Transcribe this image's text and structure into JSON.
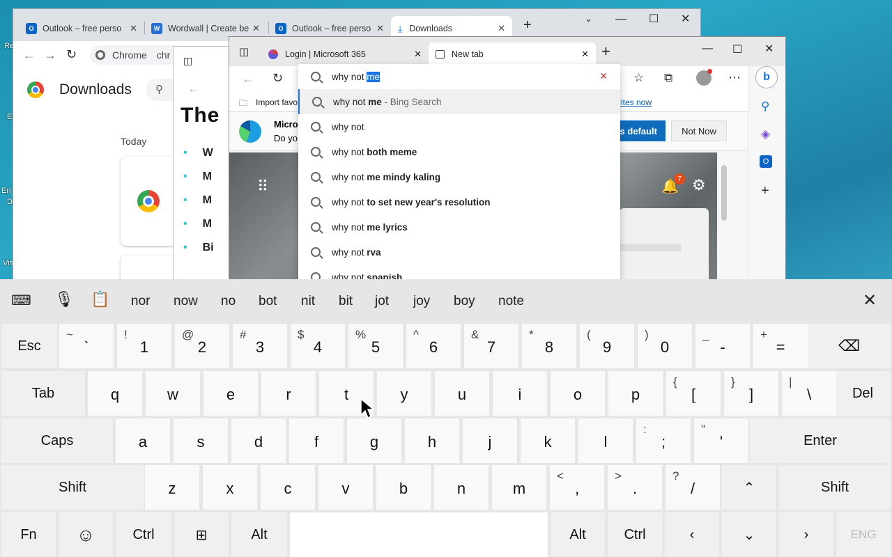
{
  "desktop": {
    "labels": [
      "Re",
      "E",
      "Ev",
      "En",
      "D",
      "Vis"
    ]
  },
  "chrome": {
    "tabs": [
      {
        "label": "Outlook – free perso",
        "icon": "outlook-icon"
      },
      {
        "label": "Wordwall | Create be",
        "icon": "wordwall-icon"
      },
      {
        "label": "Outlook – free perso",
        "icon": "outlook-icon"
      },
      {
        "label": "Downloads",
        "icon": "download-icon",
        "active": true
      }
    ],
    "address": "Chrome",
    "address_text": "chr",
    "page_title": "Downloads",
    "today": "Today"
  },
  "middle": {
    "heading": "The",
    "items": [
      "W",
      "M",
      "M",
      "M",
      "Bi"
    ]
  },
  "edge": {
    "tabs": [
      {
        "label": "Login | Microsoft 365"
      },
      {
        "label": "New tab",
        "active": true
      }
    ],
    "fav_label": "Import favo",
    "fav_link": "rites now",
    "banner_title": "Micros",
    "banner_sub": "Do yo",
    "make_default": "s default",
    "not_now": "Not Now",
    "notif_count": "7"
  },
  "search": {
    "typed": "why not ",
    "selected": "me",
    "suggestions": [
      {
        "prefix": "why not ",
        "bold": "me",
        "suffix": " - Bing Search"
      },
      {
        "prefix": "why not",
        "bold": "",
        "suffix": ""
      },
      {
        "prefix": "why not ",
        "bold": "both meme",
        "suffix": ""
      },
      {
        "prefix": "why not ",
        "bold": "me mindy kaling",
        "suffix": ""
      },
      {
        "prefix": "why not ",
        "bold": "to set new year's resolution",
        "suffix": ""
      },
      {
        "prefix": "why not ",
        "bold": "me lyrics",
        "suffix": ""
      },
      {
        "prefix": "why not ",
        "bold": "rva",
        "suffix": ""
      },
      {
        "prefix": "why not ",
        "bold": "spanish",
        "suffix": ""
      }
    ]
  },
  "keyboard": {
    "candidates": [
      "nor",
      "now",
      "no",
      "bot",
      "nit",
      "bit",
      "jot",
      "joy",
      "boy",
      "note"
    ],
    "row1": [
      [
        "~",
        "`"
      ],
      [
        "!",
        "1"
      ],
      [
        "@",
        "2"
      ],
      [
        "#",
        "3"
      ],
      [
        "$",
        "4"
      ],
      [
        "%",
        "5"
      ],
      [
        "^",
        "6"
      ],
      [
        "&",
        "7"
      ],
      [
        "*",
        "8"
      ],
      [
        "(",
        "9"
      ],
      [
        ")",
        "0"
      ],
      [
        "_",
        "-"
      ],
      [
        "+",
        "="
      ]
    ],
    "row2": [
      "q",
      "w",
      "e",
      "r",
      "t",
      "y",
      "u",
      "i",
      "o",
      "p"
    ],
    "row2_extra": [
      [
        "{",
        "["
      ],
      [
        "}",
        "]"
      ],
      [
        "|",
        "\\"
      ]
    ],
    "row3": [
      "a",
      "s",
      "d",
      "f",
      "g",
      "h",
      "j",
      "k",
      "l"
    ],
    "row3_extra": [
      [
        ":",
        ";"
      ],
      [
        "\"",
        "'"
      ]
    ],
    "row4": [
      "z",
      "x",
      "c",
      "v",
      "b",
      "n",
      "m"
    ],
    "row4_extra": [
      [
        "<",
        ","
      ],
      [
        ">",
        "."
      ],
      [
        "?",
        "/"
      ]
    ],
    "labels": {
      "esc": "Esc",
      "tab": "Tab",
      "del": "Del",
      "caps": "Caps",
      "enter": "Enter",
      "shift": "Shift",
      "fn": "Fn",
      "ctrl": "Ctrl",
      "alt": "Alt",
      "lang": "ENG"
    }
  }
}
